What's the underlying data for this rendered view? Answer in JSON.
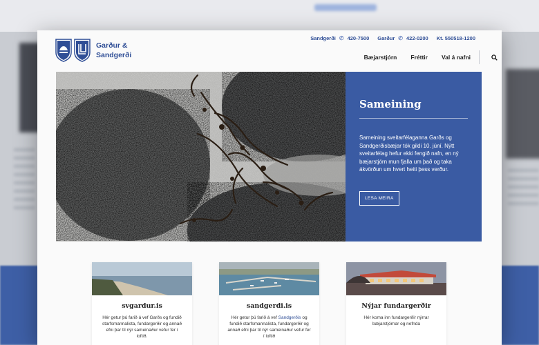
{
  "brand": {
    "name_line1": "Garður &",
    "name_line2": "Sandgerði"
  },
  "contact": [
    {
      "label": "Sandgerði",
      "phone": "420-7500"
    },
    {
      "label": "Garður",
      "phone": "422-0200"
    },
    {
      "label": "Kt. 550518-1200"
    }
  ],
  "nav": {
    "items": [
      "Bæjarstjórn",
      "Fréttir",
      "Val á nafni"
    ]
  },
  "hero": {
    "title": "Sameining",
    "body": "Sameining sveitarfélaganna Garðs og Sandgerðisbæjar tók gildi 10. júní. Nýtt sveitarfélag hefur ekki fengið nafn, en ný bæjarstjórn mun fjalla um það og taka ákvörðun um hvert heiti þess verður.",
    "button": "LESA MEIRA"
  },
  "cards": [
    {
      "title": "svgardur.is",
      "body": "Hér getur þú farið á vef Garðs og fundið starfsmannalista, fundargerðir og annað efni þar til nýr sameinaður vefur fer í loftið."
    },
    {
      "title": "sandgerdi.is",
      "body_pre": "Hér getur þú farið á vef",
      "body_link": "Sandgerðis",
      "body_post": "og fundið starfsmannalista, fundargerðir og annað efni þar til nýr sameinaður vefur fer í loftið"
    },
    {
      "title": "Nýjar fundargerðir",
      "body": "Hér koma inn fundargerðir nýrrar bæjarstjórnar og nefnda"
    }
  ],
  "colors": {
    "brand_blue": "#3a5ba3",
    "link_blue": "#2f4e96"
  },
  "icons": [
    "phone-icon",
    "search-icon",
    "shield-icon"
  ]
}
